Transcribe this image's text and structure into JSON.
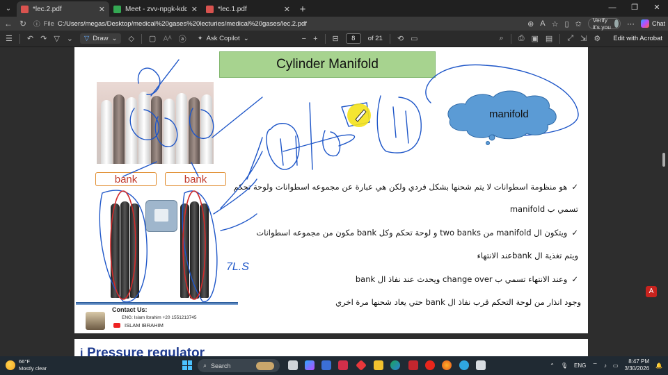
{
  "browser": {
    "tabs": [
      {
        "title": "*lec.2.pdf",
        "active": true,
        "icon_color": "#d9534f"
      },
      {
        "title": "Meet - zvv-npgk-kdd",
        "active": false,
        "icon_color": "#34a853"
      },
      {
        "title": "*lec.1.pdf",
        "active": false,
        "icon_color": "#d9534f"
      }
    ],
    "new_tab": "+",
    "url_prefix": "File",
    "url": "C:/Users/megas/Desktop/medical%20gases%20lecturies/medical%20gases/lec.2.pdf",
    "verify_label": "Verify it's you",
    "chat_label": "Chat"
  },
  "pdf_toolbar": {
    "draw_label": "Draw",
    "ask_copilot_label": "Ask Copilot",
    "zoom_out": "−",
    "zoom_in": "+",
    "page_current": "8",
    "page_total": "of 21",
    "edit_acrobat_label": "Edit with Acrobat"
  },
  "slide": {
    "title": "Cylinder Manifold",
    "bank_left": "bank",
    "bank_right": "bank",
    "cloud_label": "manifold",
    "handwritten_note": "7L.S",
    "bullets": [
      {
        "check": true,
        "text": "هو منظومة اسطوانات لا يتم شحنها بشكل فردي ولكن هي عبارة عن مجموعه اسطوانات ولوحة تحكم"
      },
      {
        "check": false,
        "text": "تسمي ب manifold"
      },
      {
        "check": true,
        "text": "ويتكون ال manifold من two banks و لوحة تحكم وكل bank مكون من مجموعه اسطوانات"
      },
      {
        "check": false,
        "text": "ويتم تغذية ال bankعند الانتهاء"
      },
      {
        "check": true,
        "text": "وعند الانتهاء تسمي ب change over ويحدث عند نفاذ ال bank"
      },
      {
        "check": false,
        "text": "وجود انذار من لوحة التحكم قرب نفاذ ال bank حتي يعاد شحنها مرة اخري"
      }
    ],
    "contact": {
      "heading": "Contact Us:",
      "line": "ENG: Islam Ibrahim +20 1551213745",
      "name": "ISLAM IBRAHIM"
    }
  },
  "next_page": {
    "bullet": "i",
    "title": "Pressure regulator"
  },
  "taskbar": {
    "temperature": "66°F",
    "weather": "Mostly clear",
    "search_placeholder": "Search",
    "language": "ENG",
    "time": "8:47 PM",
    "date": "3/30/2026"
  }
}
